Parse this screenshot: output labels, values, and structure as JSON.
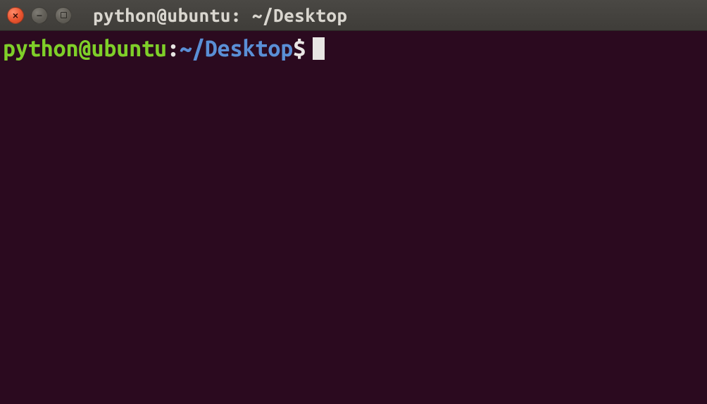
{
  "window": {
    "title": "python@ubuntu: ~/Desktop"
  },
  "prompt": {
    "user_host": "python@ubuntu",
    "separator": ":",
    "path": "~/Desktop",
    "symbol": "$"
  },
  "glyphs": {
    "close": "×",
    "minimize": "−"
  }
}
